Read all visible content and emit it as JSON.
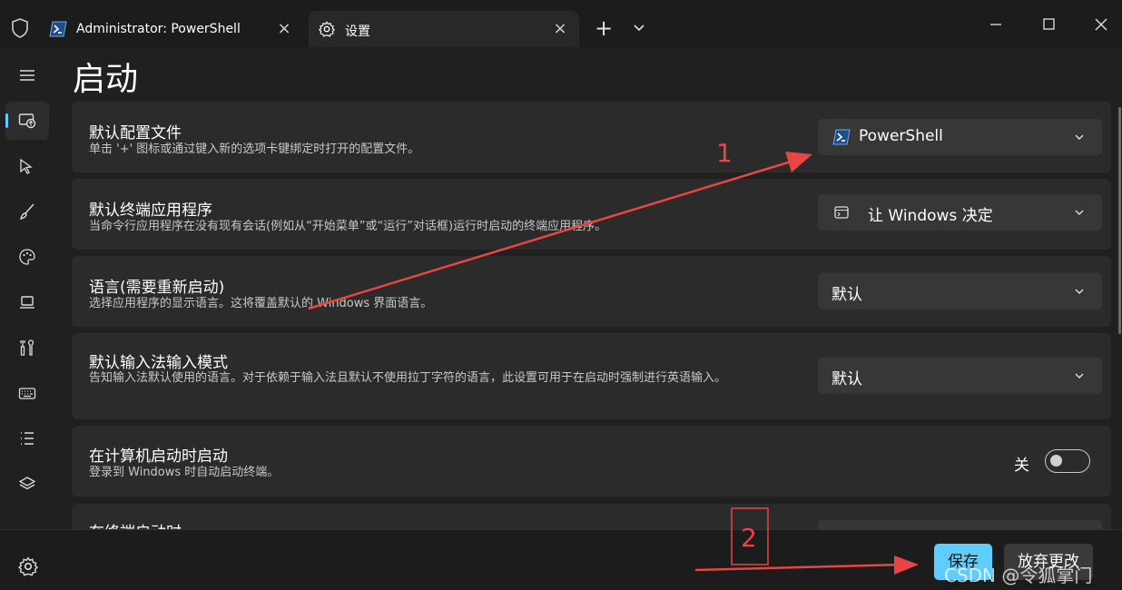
{
  "titlebar": {
    "tabs": [
      {
        "title": "Administrator: PowerShell",
        "icon": "powershell-icon"
      },
      {
        "title": "设置",
        "icon": "gear-icon"
      }
    ],
    "new_tab": "+"
  },
  "page": {
    "title": "启动"
  },
  "settings": [
    {
      "title": "默认配置文件",
      "description": "单击 '+' 图标或通过键入新的选项卡键绑定时打开的配置文件。",
      "value": "PowerShell",
      "icon": "powershell-icon"
    },
    {
      "title": "默认终端应用程序",
      "description": "当命令行应用程序在没有现有会话(例如从“开始菜单”或“运行”对话框)运行时启动的终端应用程序。",
      "value": "让 Windows 决定",
      "icon": "terminal-app-icon"
    },
    {
      "title": "语言(需要重新启动)",
      "description": "选择应用程序的显示语言。这将覆盖默认的 Windows 界面语言。",
      "value": "默认"
    },
    {
      "title": "默认输入法输入模式",
      "description": "告知输入法默认使用的语言。对于依赖于输入法且默认不使用拉丁字符的语言，此设置可用于在启动时强制进行英语输入。",
      "value": "默认"
    },
    {
      "title": "在计算机启动时启动",
      "description": "登录到 Windows 时自动启动终端。",
      "toggle_label": "关",
      "toggle_on": false
    },
    {
      "title": "在终端启动时"
    }
  ],
  "footer": {
    "save": "保存",
    "discard": "放弃更改"
  },
  "annotations": {
    "arrow1": "1",
    "arrow2": "2",
    "color": "#e84545"
  },
  "watermark": "CSDN @令狐掌门",
  "colors": {
    "accent": "#60cdff",
    "card": "#2b2b2b",
    "background": "#202020"
  }
}
